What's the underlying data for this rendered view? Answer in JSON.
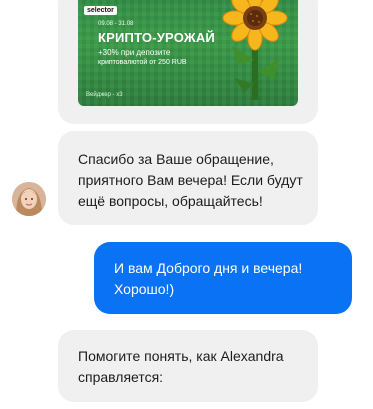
{
  "messages": [
    {
      "from": "agent",
      "type": "image-banner",
      "banner": {
        "brand": "selector",
        "dates": "09.08 - 31.08",
        "headline": "КРИПТО-УРОЖАЙ",
        "line1": "+30% при депозите",
        "line2": "криптовалютой от 250 RUB",
        "wager": "Вейджер - х3"
      }
    },
    {
      "from": "agent",
      "text": "Спасибо за Ваше обращение, приятного Вам вечера! Если будут ещё вопросы, обращайтесь!"
    },
    {
      "from": "user",
      "text": "И вам Доброго дня и вечера! Хорошо!)"
    },
    {
      "from": "agent",
      "text": "Помогите понять, как Alexandra справляется:"
    }
  ],
  "colors": {
    "agent_bubble": "#f0f0f1",
    "user_bubble": "#0a72f5",
    "banner_green": "#3a9b47"
  },
  "icons": {
    "avatar": "agent-avatar",
    "banner_art": "sunflower-icon"
  }
}
